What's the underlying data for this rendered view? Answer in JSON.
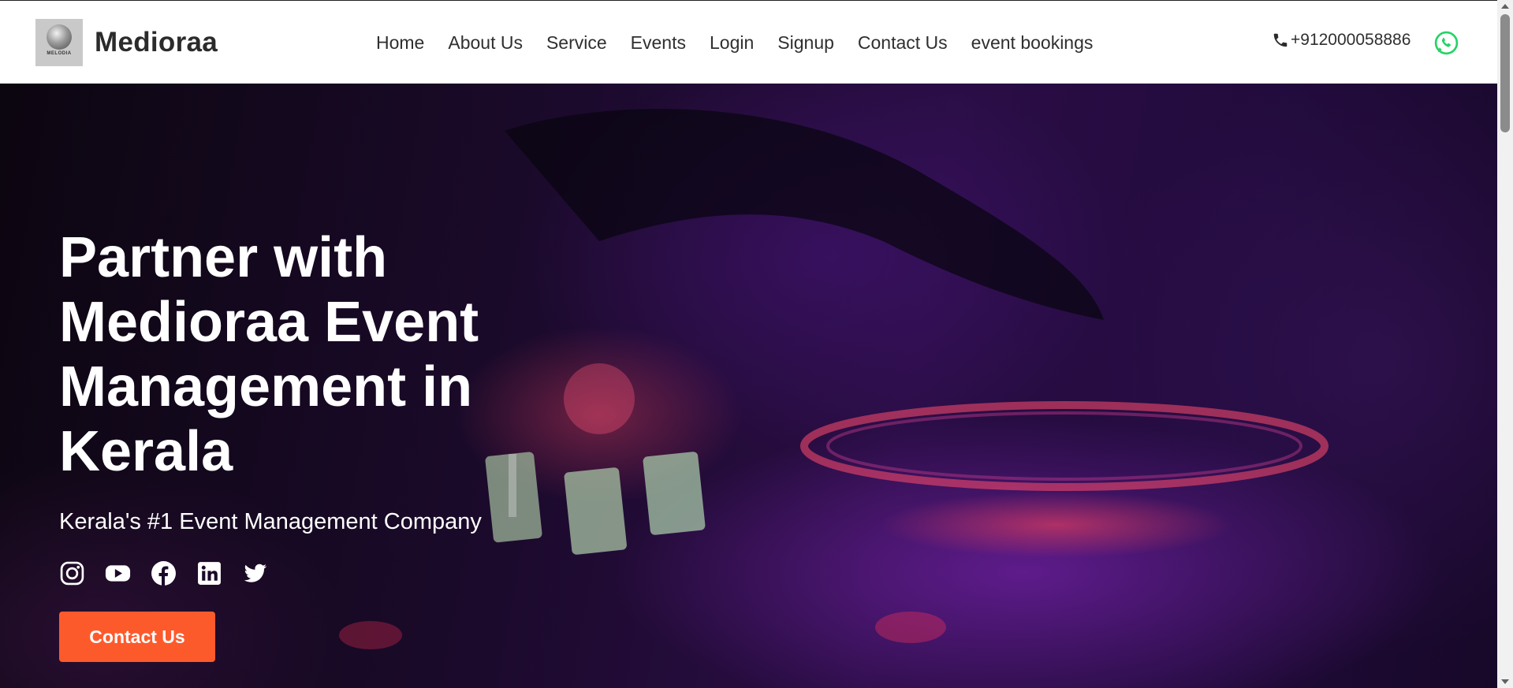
{
  "brand": {
    "name": "Medioraa",
    "logo_text": "MELODIA"
  },
  "nav": {
    "links": [
      "Home",
      "About Us",
      "Service",
      "Events",
      "Login",
      "Signup",
      "Contact Us",
      "event bookings"
    ]
  },
  "contact": {
    "phone": "+912000058886",
    "whatsapp_icon": "whatsapp-icon"
  },
  "hero": {
    "title": "Partner with Medioraa Event Management in Kerala",
    "subtitle": "Kerala's #1 Event Management Company",
    "socials": [
      "instagram-icon",
      "youtube-icon",
      "facebook-icon",
      "linkedin-icon",
      "twitter-icon"
    ],
    "cta_label": "Contact Us"
  },
  "colors": {
    "accent": "#fd5a2c",
    "whatsapp": "#25d366",
    "nav_text": "#2f2f2f",
    "hero_overlay": "#2a0d45"
  }
}
